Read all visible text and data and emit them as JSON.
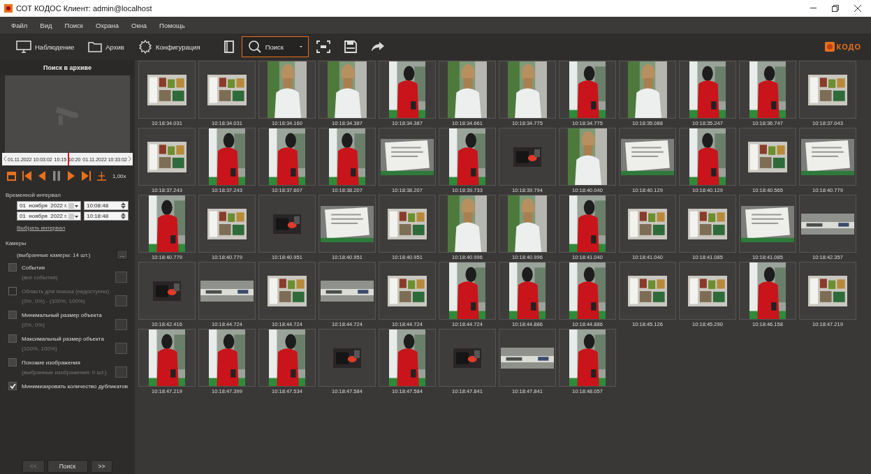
{
  "window": {
    "title": "СОТ КОДОС Клиент: admin@localhost"
  },
  "menu": [
    "Файл",
    "Вид",
    "Поиск",
    "Охрана",
    "Окна",
    "Помощь"
  ],
  "toolbar": {
    "items": [
      {
        "kind": "monitor",
        "label": "Наблюдение",
        "selected": false
      },
      {
        "kind": "folder",
        "label": "Архив",
        "selected": false
      },
      {
        "kind": "gear",
        "label": "Конфигурация",
        "selected": false
      },
      {
        "kind": "book",
        "selected": false
      },
      {
        "kind": "search",
        "label": "Поиск",
        "selected": true
      },
      {
        "kind": "fullscreen",
        "selected": false
      },
      {
        "kind": "save",
        "selected": false
      },
      {
        "kind": "share",
        "selected": false
      }
    ],
    "logo": "КОДО"
  },
  "search_panel": {
    "title": "Поиск в архиве",
    "timeline": {
      "labels": [
        "01.11.2022 10:03:02",
        "10:15",
        "10:20",
        "01.11.2022 10:33:02"
      ],
      "level": 0.5
    },
    "speed": "1,00x",
    "interval_label": "Временной интервал",
    "intervals": [
      {
        "date": "01  ноября  2022 г.",
        "time": "10:08:48"
      },
      {
        "date": "01  ноября  2022 г.",
        "time": "10:18:48"
      }
    ],
    "interval_link": "Выбрать интервал",
    "cameras_label": "Камеры",
    "cameras_value": "(выбранные камеры: 14 шт.)",
    "cameras_button": "...",
    "filters": [
      {
        "label": "События",
        "detail": "(все события)",
        "checked": false,
        "disabled": false
      },
      {
        "label": "Область для поиска (недоступно)",
        "detail": "(0%, 0%) - (100%, 100%)",
        "checked": false,
        "disabled": true
      },
      {
        "label": "Минимальный размер объекта",
        "detail": "(0%, 0%)",
        "checked": false,
        "disabled": false
      },
      {
        "label": "Максимальный размер объекта",
        "detail": "(100%, 100%)",
        "checked": false,
        "disabled": false
      },
      {
        "label": "Похожие изображения",
        "detail": "(выбранные изображения: 0 шт.)",
        "checked": false,
        "disabled": false
      },
      {
        "label": "Минимизировать количество дубликатов",
        "checked": true,
        "disabled": false
      }
    ],
    "buttons": [
      {
        "label": "<<",
        "disabled": true
      },
      {
        "label": "Поиск",
        "disabled": false
      },
      {
        "label": ">>",
        "disabled": false
      }
    ]
  },
  "results": [
    {
      "time": "10:18:34.031"
    },
    {
      "time": "10:18:34.031"
    },
    {
      "time": "10:18:34.160"
    },
    {
      "time": "10:18:34.387"
    },
    {
      "time": "10:18:34.387"
    },
    {
      "time": "10:18:34.661"
    },
    {
      "time": "10:18:34.775"
    },
    {
      "time": "10:18:34.775"
    },
    {
      "time": "10:18:35.088"
    },
    {
      "time": "10:18:35.247"
    },
    {
      "time": "10:18:36.747"
    },
    {
      "time": "10:18:37.043"
    },
    {
      "time": "10:18:37.243"
    },
    {
      "time": "10:18:37.243"
    },
    {
      "time": "10:18:37.607"
    },
    {
      "time": "10:18:38.207"
    },
    {
      "time": "10:18:38.207"
    },
    {
      "time": "10:18:39.733"
    },
    {
      "time": "10:18:39.794"
    },
    {
      "time": "10:18:40.040"
    },
    {
      "time": "10:18:40.129"
    },
    {
      "time": "10:18:40.129"
    },
    {
      "time": "10:18:40.565"
    },
    {
      "time": "10:18:40.779"
    },
    {
      "time": "10:18:40.779"
    },
    {
      "time": "10:18:40.779"
    },
    {
      "time": "10:18:40.951"
    },
    {
      "time": "10:18:40.951"
    },
    {
      "time": "10:18:40.951"
    },
    {
      "time": "10:18:40.996"
    },
    {
      "time": "10:18:40.996"
    },
    {
      "time": "10:18:41.040"
    },
    {
      "time": "10:18:41.040"
    },
    {
      "time": "10:18:41.085"
    },
    {
      "time": "10:18:41.085"
    },
    {
      "time": "10:18:42.357"
    },
    {
      "time": "10:18:42.416"
    },
    {
      "time": "10:18:44.724"
    },
    {
      "time": "10:18:44.724"
    },
    {
      "time": "10:18:44.724"
    },
    {
      "time": "10:18:44.724"
    },
    {
      "time": "10:18:44.724"
    },
    {
      "time": "10:18:44.886"
    },
    {
      "time": "10:18:44.886"
    },
    {
      "time": "10:18:45.126"
    },
    {
      "time": "10:18:45.290"
    },
    {
      "time": "10:18:46.158"
    },
    {
      "time": "10:18:47.219"
    },
    {
      "time": "10:18:47.219"
    },
    {
      "time": "10:18:47.399"
    },
    {
      "time": "10:18:47.534"
    },
    {
      "time": "10:18:47.584"
    },
    {
      "time": "10:18:47.584"
    },
    {
      "time": "10:18:47.841"
    },
    {
      "time": "10:18:47.841"
    },
    {
      "time": "10:18:48.057"
    }
  ]
}
